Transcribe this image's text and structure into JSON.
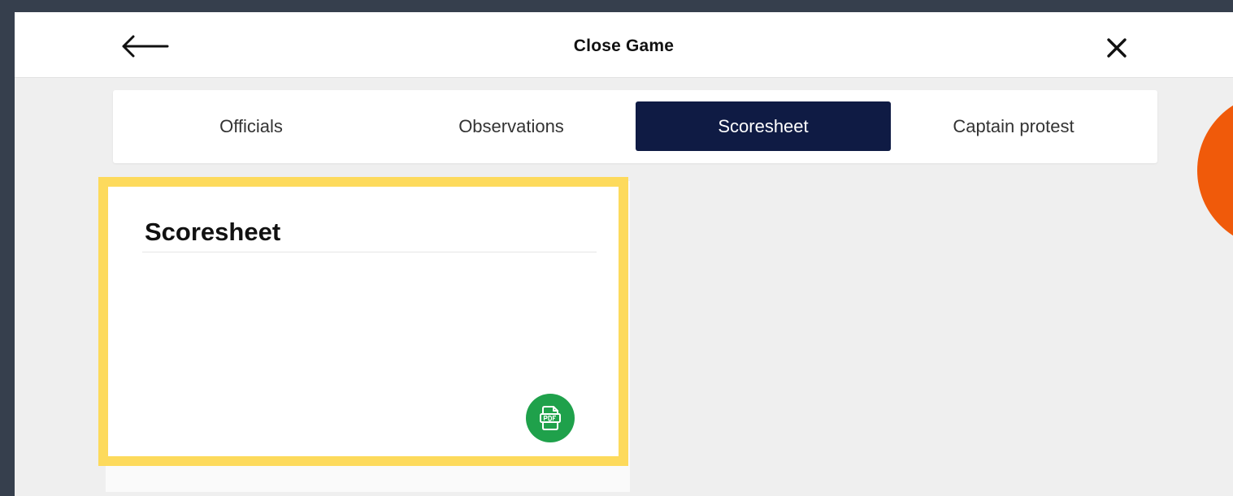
{
  "header": {
    "title": "Close Game",
    "back_icon": "arrow-left-icon",
    "close_icon": "close-icon"
  },
  "tabs": [
    {
      "label": "Officials",
      "active": false
    },
    {
      "label": "Observations",
      "active": false
    },
    {
      "label": "Scoresheet",
      "active": true
    },
    {
      "label": "Captain protest",
      "active": false
    }
  ],
  "card": {
    "title": "Scoresheet",
    "pdf_icon": "pdf-file-icon"
  },
  "colors": {
    "background": "#363f4d",
    "active_tab": "#0f1b44",
    "highlight": "#fdda5c",
    "pdf_button": "#1fa14b",
    "accent_orange": "#f05a0a"
  }
}
